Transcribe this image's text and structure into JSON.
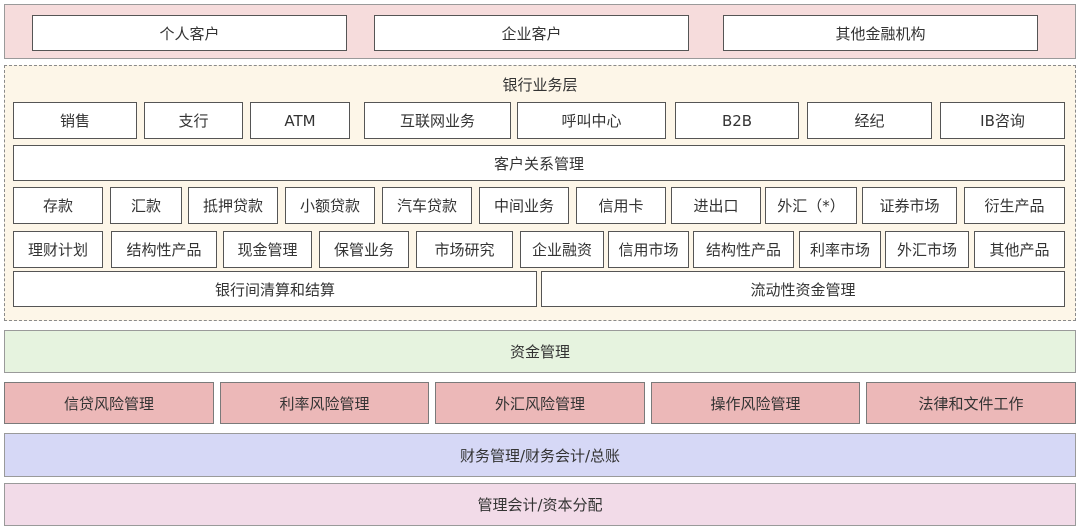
{
  "customers": [
    "个人客户",
    "企业客户",
    "其他金融机构"
  ],
  "bank_layer": {
    "title": "银行业务层",
    "channels": [
      "销售",
      "支行",
      "ATM",
      "互联网业务",
      "呼叫中心",
      "B2B",
      "经纪",
      "IB咨询"
    ],
    "crm": "客户关系管理",
    "products_row1": [
      "存款",
      "汇款",
      "抵押贷款",
      "小额贷款",
      "汽车贷款",
      "中间业务",
      "信用卡",
      "进出口",
      "外汇（*）",
      "证券市场",
      "衍生产品"
    ],
    "products_row2": [
      "理财计划",
      "结构性产品",
      "现金管理",
      "保管业务",
      "市场研究",
      "企业融资",
      "信用市场",
      "结构性产品",
      "利率市场",
      "外汇市场",
      "其他产品"
    ],
    "settlement": [
      "银行间清算和结算",
      "流动性资金管理"
    ]
  },
  "treasury": "资金管理",
  "risk": [
    "信贷风险管理",
    "利率风险管理",
    "外汇风险管理",
    "操作风险管理",
    "法律和文件工作"
  ],
  "finance": "财务管理/财务会计/总账",
  "management": "管理会计/资本分配",
  "colors": {
    "customers_bg": "#f6dcdc",
    "bank_layer_bg": "#fdf6e8",
    "treasury_bg": "#e6f3df",
    "risk_bg": "#ecb8b8",
    "finance_bg": "#d6d8f6",
    "management_bg": "#f2dbe8"
  }
}
